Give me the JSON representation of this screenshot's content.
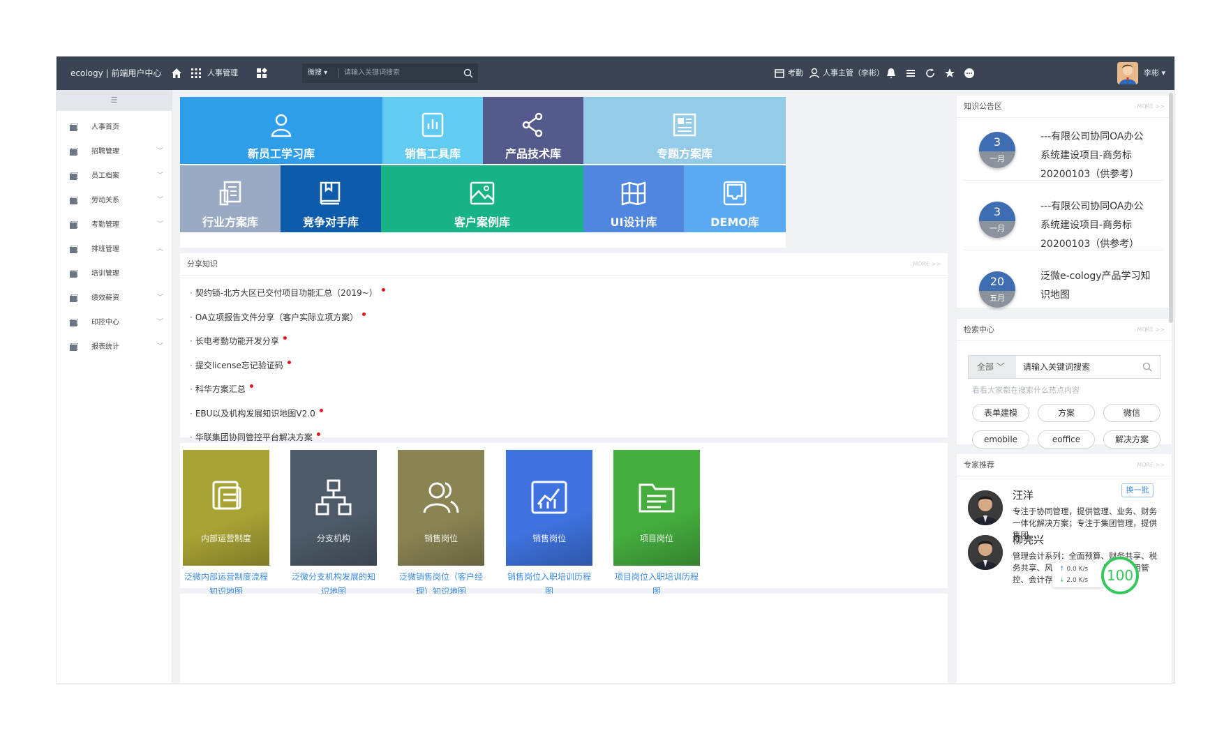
{
  "topbar": {
    "brand": "ecology | 前端用户中心",
    "module": "人事管理",
    "search_scope": "微搜",
    "search_placeholder": "请输入关键词搜索",
    "attendance": "考勤",
    "role": "人事主管（李彬）",
    "user": "李彬"
  },
  "sidebar": {
    "collapse_glyph": "☰",
    "items": [
      {
        "label": "人事首页",
        "chev": ""
      },
      {
        "label": "招聘管理",
        "chev": "﹀"
      },
      {
        "label": "员工档案",
        "chev": "﹀"
      },
      {
        "label": "劳动关系",
        "chev": "﹀"
      },
      {
        "label": "考勤管理",
        "chev": "﹀"
      },
      {
        "label": "排班管理",
        "chev": "︿"
      },
      {
        "label": "培训管理",
        "chev": ""
      },
      {
        "label": "绩效薪资",
        "chev": "﹀"
      },
      {
        "label": "印控中心",
        "chev": "﹀"
      },
      {
        "label": "报表统计",
        "chev": "﹀"
      }
    ]
  },
  "tiles": [
    {
      "label": "新员工学习库",
      "color": "#2e9ee8",
      "icon": "user-icon"
    },
    {
      "label": "销售工具库",
      "color": "#62cbf2",
      "icon": "chart-icon"
    },
    {
      "label": "产品技术库",
      "color": "#555a8c",
      "icon": "share-icon"
    },
    {
      "label": "专题方案库",
      "color": "#94cbe8",
      "icon": "newspaper-icon"
    },
    {
      "label": "行业方案库",
      "color": "#9aaac2",
      "icon": "document-icon"
    },
    {
      "label": "竞争对手库",
      "color": "#0d5cab",
      "icon": "book-icon"
    },
    {
      "label": "客户案例库",
      "color": "#17b387",
      "icon": "image-icon"
    },
    {
      "label": "UI设计库",
      "color": "#4f86e0",
      "icon": "map-icon"
    },
    {
      "label": "DEMO库",
      "color": "#59aaf0",
      "icon": "inbox-icon"
    }
  ],
  "share": {
    "title": "分享知识",
    "more": "MORE >>",
    "items": [
      "契约锁-北方大区已交付项目功能汇总（2019~）",
      "OA立项报告文件分享（客户实际立项方案）",
      "长电考勤功能开发分享",
      "提交license忘记验证码",
      "科华方案汇总",
      "EBU以及机构发展知识地图V2.0",
      "华联集团协同管控平台解决方案"
    ]
  },
  "maps": [
    {
      "label": "内部运营制度",
      "caption": "泛微内部运营制度流程知识地图",
      "color": "#a8a335"
    },
    {
      "label": "分支机构",
      "caption": "泛微分支机构发展的知识地图",
      "color": "#4e5a68"
    },
    {
      "label": "销售岗位",
      "caption": "泛微销售岗位（客户经理）知识地图",
      "color": "#8a8454"
    },
    {
      "label": "销售岗位",
      "caption": "销售岗位入职培训历程图",
      "color": "#3f73e0"
    },
    {
      "label": "项目岗位",
      "caption": "项目岗位入职培训历程图",
      "color": "#45ad3e"
    }
  ],
  "notices": {
    "title": "知识公告区",
    "more": "MORE >>",
    "items": [
      {
        "day": "3",
        "month": "一月",
        "text": "---有限公司协同OA办公系统建设项目-商务标20200103（供参考）"
      },
      {
        "day": "3",
        "month": "一月",
        "text": "---有限公司协同OA办公系统建设项目-商务标20200103（供参考）"
      },
      {
        "day": "20",
        "month": "五月",
        "text": "泛微e-cology产品学习知识地图"
      }
    ]
  },
  "search_center": {
    "title": "检索中心",
    "more": "MORE >>",
    "scope": "全部",
    "placeholder": "请输入关键词搜索",
    "hot_tip": "看看大家都在搜索什么热点内容",
    "tags": [
      "表单建模",
      "方案",
      "微信",
      "emobile",
      "eoffice",
      "解决方案"
    ]
  },
  "experts": {
    "title": "专家推荐",
    "more": "MORE >>",
    "swap": "换一批",
    "items": [
      {
        "name": "汪洋",
        "desc": "专注于协同管理，提供管理、业务、财务一体化解决方案；专注于集团管理，提供集团..."
      },
      {
        "name": "柳亮兴",
        "desc": "管理会计系列：全面预算、财务共享、税务共享、风险内控、电子报账、费用管控、会计存证、阿米巴..."
      }
    ]
  },
  "speed_widget": {
    "up": "0.0 K/s",
    "down": "2.0 K/s",
    "percent": "100"
  }
}
